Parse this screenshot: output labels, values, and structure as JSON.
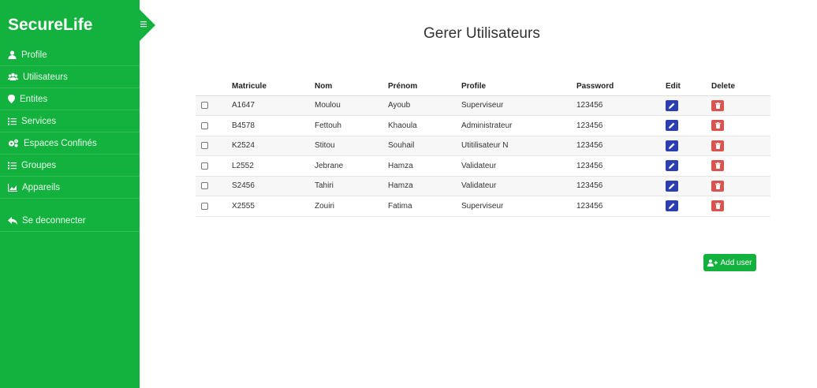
{
  "brand": "SecureLife",
  "sidebar": {
    "items": [
      {
        "label": "Profile",
        "icon": "user-icon"
      },
      {
        "label": "Utilisateurs",
        "icon": "users-icon"
      },
      {
        "label": "Entites",
        "icon": "map-pin-icon"
      },
      {
        "label": "Services",
        "icon": "list-check-icon"
      },
      {
        "label": "Espaces Confinés",
        "icon": "cogs-icon"
      },
      {
        "label": "Groupes",
        "icon": "list-icon"
      },
      {
        "label": "Appareils",
        "icon": "chart-area-icon"
      }
    ],
    "logout": {
      "label": "Se deconnecter",
      "icon": "reply-icon"
    }
  },
  "page": {
    "title": "Gerer Utilisateurs"
  },
  "table": {
    "headers": [
      "",
      "Matricule",
      "Nom",
      "Prénom",
      "Profile",
      "Password",
      "Edit",
      "Delete"
    ],
    "rows": [
      {
        "matricule": "A1647",
        "nom": "Moulou",
        "prenom": "Ayoub",
        "profile": "Superviseur",
        "password": "123456"
      },
      {
        "matricule": "B4578",
        "nom": "Fettouh",
        "prenom": "Khaoula",
        "profile": "Administrateur",
        "password": "123456"
      },
      {
        "matricule": "K2524",
        "nom": "Stitou",
        "prenom": "Souhail",
        "profile": "Utitilisateur N",
        "password": "123456"
      },
      {
        "matricule": "L2552",
        "nom": "Jebrane",
        "prenom": "Hamza",
        "profile": "Validateur",
        "password": "123456"
      },
      {
        "matricule": "S2456",
        "nom": "Tahiri",
        "prenom": "Hamza",
        "profile": "Validateur",
        "password": "123456"
      },
      {
        "matricule": "X2555",
        "nom": "Zouiri",
        "prenom": "Fatima",
        "profile": "Superviseur",
        "password": "123456"
      }
    ]
  },
  "add_button": {
    "label": "Add user",
    "icon": "user-plus-icon"
  },
  "colors": {
    "sidebar": "#13b13d",
    "edit": "#2c3fb1",
    "delete": "#d9534f",
    "add": "#13b13d"
  }
}
